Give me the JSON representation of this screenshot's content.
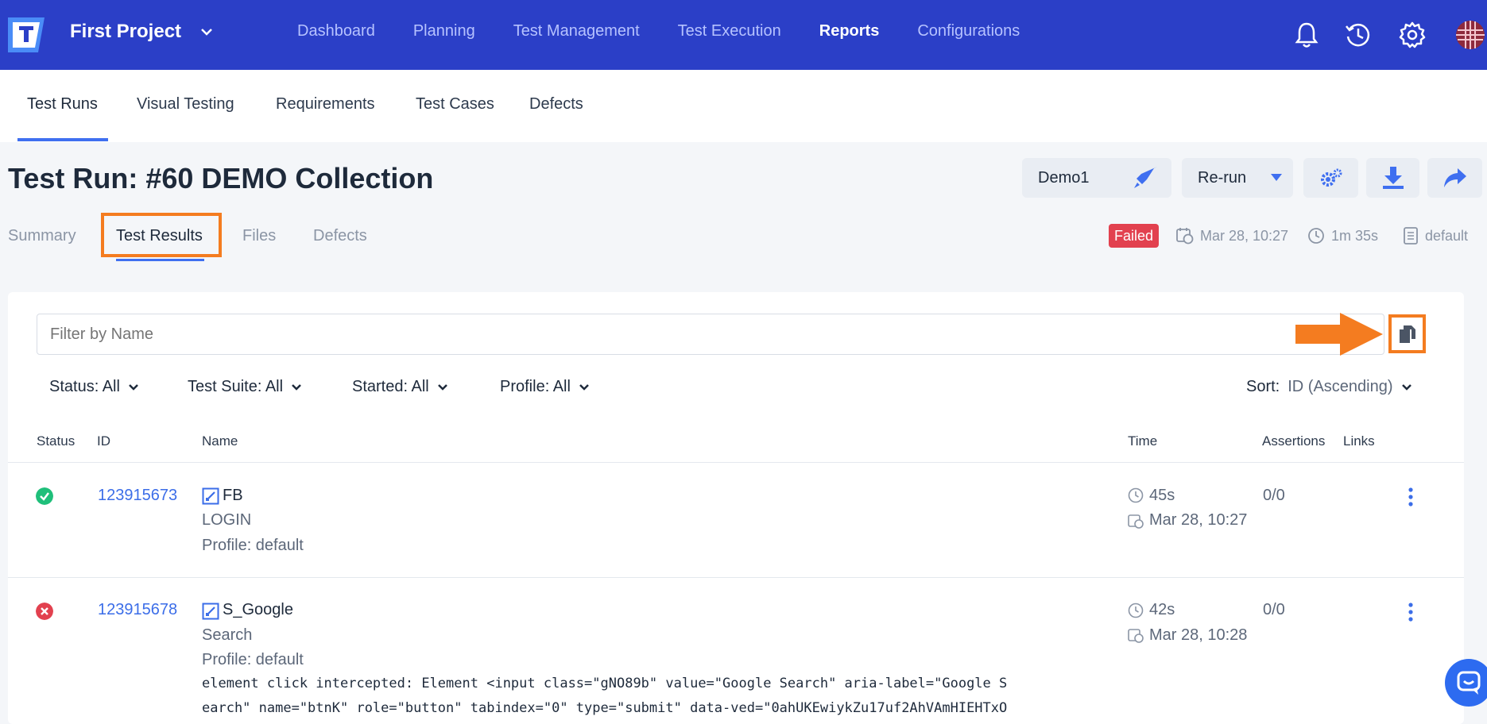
{
  "topbar": {
    "project": "First Project",
    "nav": [
      {
        "label": "Dashboard",
        "active": false
      },
      {
        "label": "Planning",
        "active": false
      },
      {
        "label": "Test Management",
        "active": false
      },
      {
        "label": "Test Execution",
        "active": false
      },
      {
        "label": "Reports",
        "active": true
      },
      {
        "label": "Configurations",
        "active": false
      }
    ],
    "icons": [
      "bell-icon",
      "history-icon",
      "gear-icon",
      "avatar"
    ]
  },
  "subnav": {
    "tabs": [
      "Test Runs",
      "Visual Testing",
      "Requirements",
      "Test Cases",
      "Defects"
    ],
    "active": "Test Runs"
  },
  "header": {
    "title": "Test Run: #60 DEMO Collection",
    "demo_label": "Demo1",
    "rerun_label": "Re-run"
  },
  "run_tabs": {
    "tabs": [
      "Summary",
      "Test Results",
      "Files",
      "Defects"
    ],
    "active": "Test Results"
  },
  "run_meta": {
    "status": "Failed",
    "date": "Mar 28, 10:27",
    "duration": "1m 35s",
    "profile": "default"
  },
  "filter": {
    "placeholder": "Filter by Name"
  },
  "dropdowns": {
    "status": "Status: All",
    "suite": "Test Suite: All",
    "started": "Started: All",
    "profile": "Profile: All",
    "sort_label": "Sort:",
    "sort_value": "ID (Ascending)"
  },
  "table": {
    "headers": {
      "status": "Status",
      "id": "ID",
      "name": "Name",
      "time": "Time",
      "assertions": "Assertions",
      "links": "Links"
    },
    "rows": [
      {
        "status": "passed",
        "id": "123915673",
        "name": "FB",
        "suite": "LOGIN",
        "profile": "Profile: default",
        "duration": "45s",
        "date": "Mar 28, 10:27",
        "assertions": "0/0"
      },
      {
        "status": "failed",
        "id": "123915678",
        "name": "S_Google",
        "suite": "Search",
        "profile": "Profile: default",
        "duration": "42s",
        "date": "Mar 28, 10:28",
        "assertions": "0/0",
        "error_line1": "element click intercepted: Element <input class=\"gNO89b\" value=\"Google Search\" aria-label=\"Google S",
        "error_line2": "earch\" name=\"btnK\" role=\"button\" tabindex=\"0\" type=\"submit\" data-ved=\"0ahUKEwiykZu17uf2AhVAmHIEHTxO"
      }
    ]
  },
  "colors": {
    "topbar": "#2b3fc7",
    "accent": "#3f6ff0",
    "highlight": "#f47c20",
    "failed": "#e2414f",
    "passed": "#1fbf7a"
  }
}
